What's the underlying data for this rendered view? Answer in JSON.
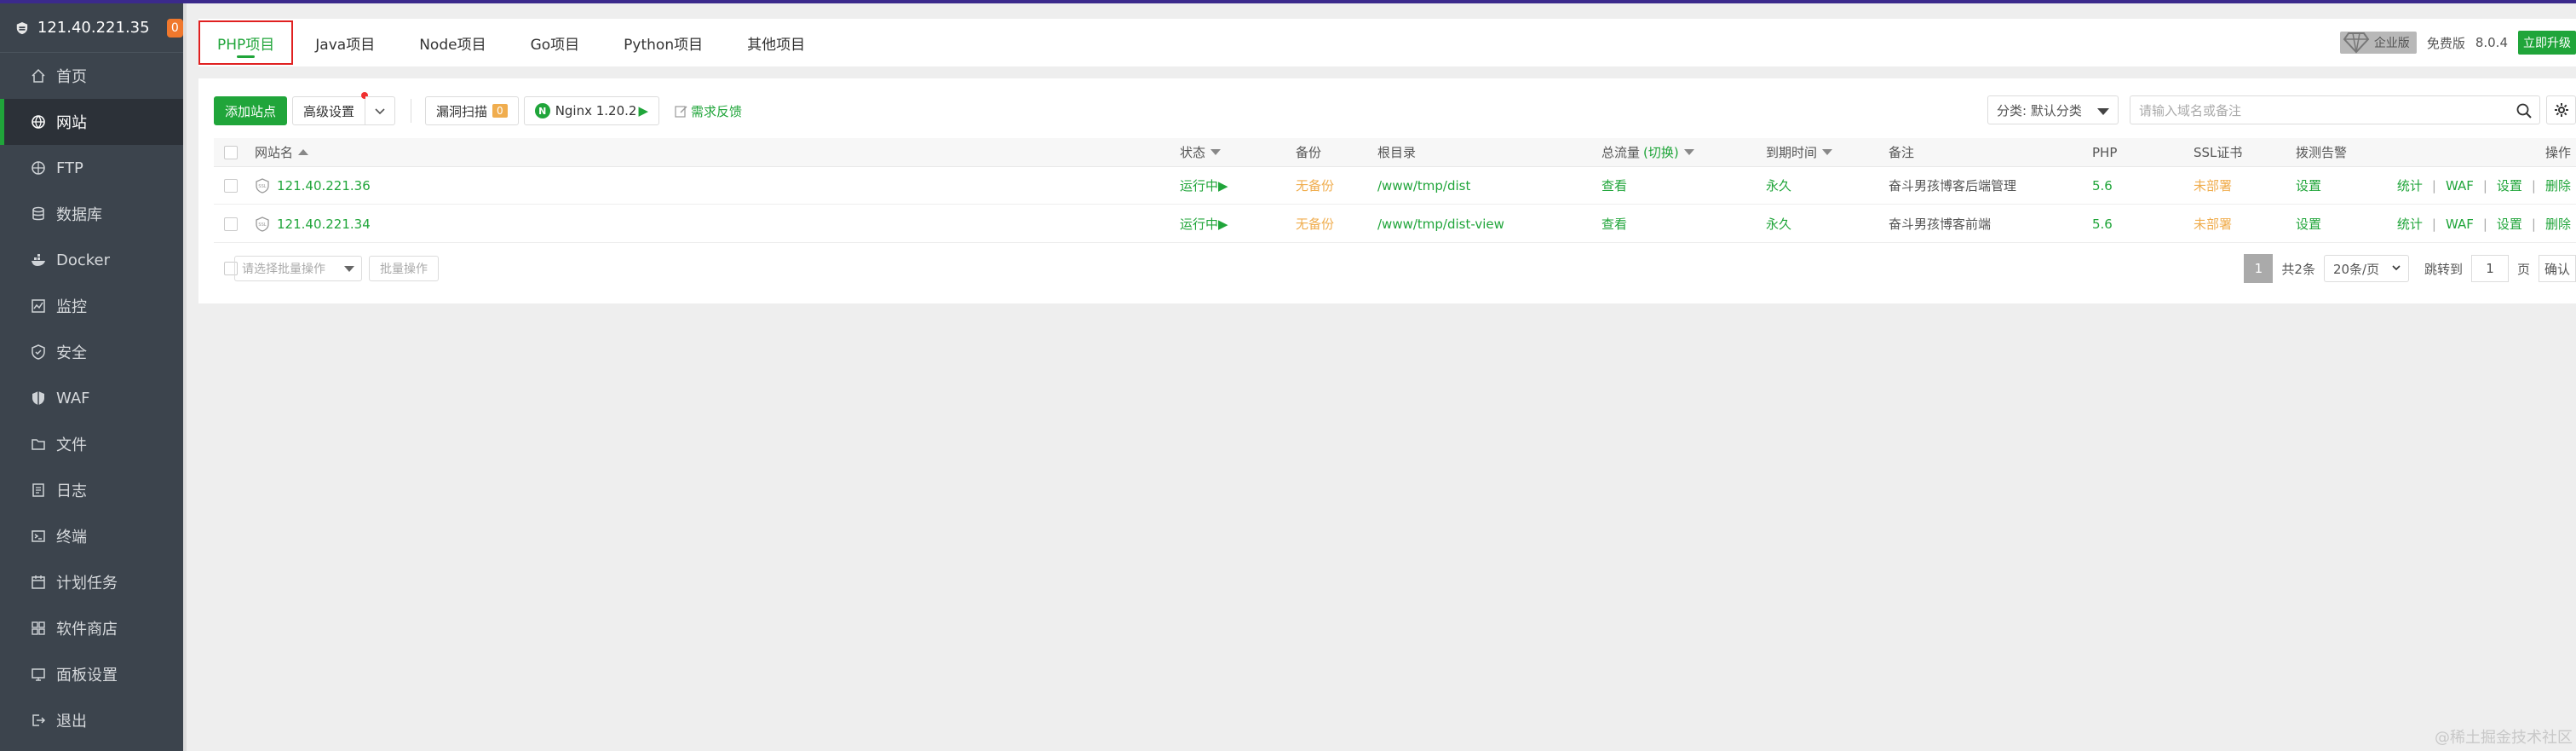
{
  "server": {
    "ip": "121.40.221.35",
    "badge": "0"
  },
  "sidebar": {
    "items": [
      {
        "label": "首页",
        "icon": "home-icon"
      },
      {
        "label": "网站",
        "icon": "globe-icon",
        "active": true
      },
      {
        "label": "FTP",
        "icon": "ftp-icon"
      },
      {
        "label": "数据库",
        "icon": "database-icon"
      },
      {
        "label": "Docker",
        "icon": "docker-icon"
      },
      {
        "label": "监控",
        "icon": "monitor-icon"
      },
      {
        "label": "安全",
        "icon": "shield-icon"
      },
      {
        "label": "WAF",
        "icon": "waf-icon"
      },
      {
        "label": "文件",
        "icon": "folder-icon"
      },
      {
        "label": "日志",
        "icon": "log-icon"
      },
      {
        "label": "终端",
        "icon": "terminal-icon"
      },
      {
        "label": "计划任务",
        "icon": "calendar-icon"
      },
      {
        "label": "软件商店",
        "icon": "apps-icon"
      },
      {
        "label": "面板设置",
        "icon": "settings-icon"
      },
      {
        "label": "退出",
        "icon": "logout-icon"
      }
    ]
  },
  "tabs": {
    "items": [
      "PHP项目",
      "Java项目",
      "Node项目",
      "Go项目",
      "Python项目",
      "其他项目"
    ],
    "edition": "企业版",
    "free": "免费版",
    "version": "8.0.4",
    "upgrade": "立即升级"
  },
  "toolbar": {
    "add_site": "添加站点",
    "advanced": "高级设置",
    "vuln_scan": "漏洞扫描",
    "vuln_count": "0",
    "nginx": "Nginx 1.20.2",
    "feedback": "需求反馈",
    "category": "分类: 默认分类",
    "search_placeholder": "请输入域名或备注"
  },
  "table": {
    "headers": {
      "name": "网站名",
      "status": "状态",
      "backup": "备份",
      "root": "根目录",
      "traffic": "总流量",
      "traffic_switch": "(切换)",
      "expire": "到期时间",
      "note": "备注",
      "php": "PHP",
      "ssl": "SSL证书",
      "alert": "拨测告警",
      "ops": "操作"
    },
    "rows": [
      {
        "name": "121.40.221.36",
        "status": "运行中▶",
        "backup": "无备份",
        "root": "/www/tmp/dist",
        "traffic": "查看",
        "expire": "永久",
        "note": "奋斗男孩博客后端管理",
        "php": "5.6",
        "ssl": "未部署",
        "alert": "设置",
        "ops": [
          "统计",
          "WAF",
          "设置",
          "删除"
        ]
      },
      {
        "name": "121.40.221.34",
        "status": "运行中▶",
        "backup": "无备份",
        "root": "/www/tmp/dist-view",
        "traffic": "查看",
        "expire": "永久",
        "note": "奋斗男孩博客前端",
        "php": "5.6",
        "ssl": "未部署",
        "alert": "设置",
        "ops": [
          "统计",
          "WAF",
          "设置",
          "删除"
        ]
      }
    ]
  },
  "footer": {
    "batch_select": "请选择批量操作",
    "batch_button": "批量操作",
    "page": "1",
    "total": "共2条",
    "page_size": "20条/页",
    "jump_label": "跳转到",
    "jump_value": "1",
    "page_unit": "页",
    "confirm": "确认"
  },
  "watermark": "@稀土掘金技术社区",
  "colors": {
    "accent": "#20a53a",
    "sidebar_bg": "#3c444d",
    "warning": "#f0ad4e",
    "highlight_border": "#e02020"
  }
}
